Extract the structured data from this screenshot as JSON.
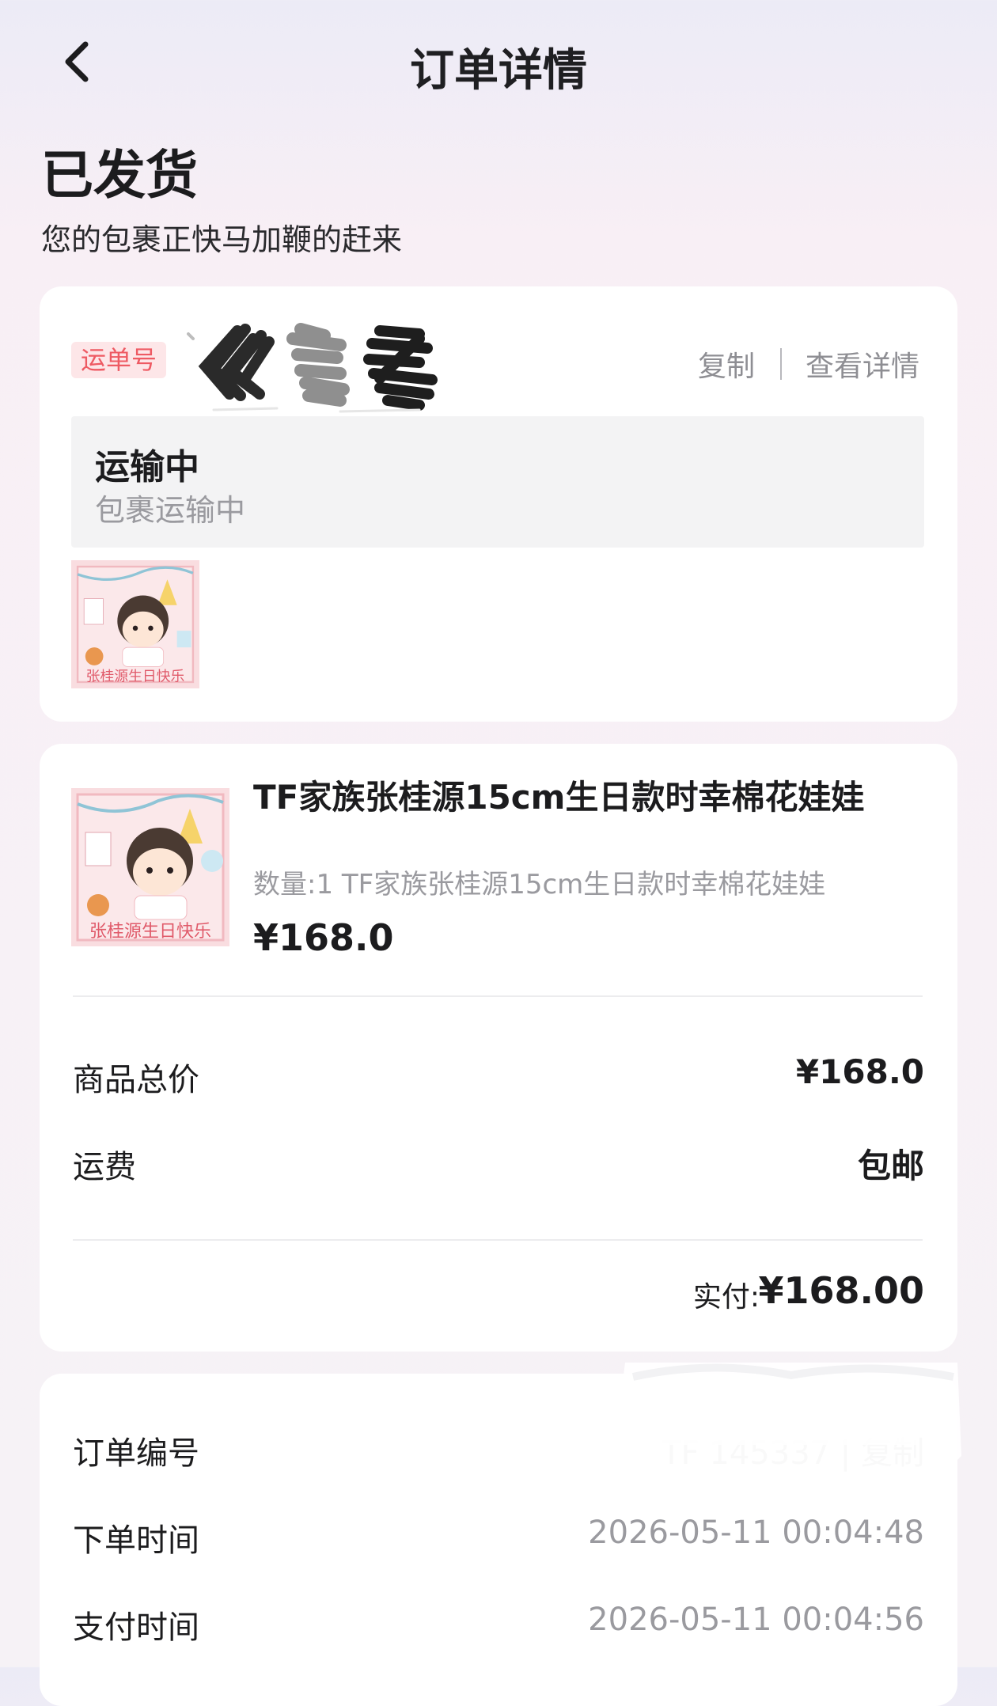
{
  "nav": {
    "title": "订单详情",
    "back_icon": "chevron-left-icon"
  },
  "status": {
    "title": "已发货",
    "subtitle": "您的包裹正快马加鞭的赶来"
  },
  "shipping": {
    "waybill_label": "运单号",
    "copy_label": "复制",
    "separator": "|",
    "detail_label": "查看详情",
    "state_title": "运输中",
    "state_subtitle": "包裹运输中",
    "thumb_caption": "张桂源生日快乐"
  },
  "product": {
    "name": "TF家族张桂源15cm生日款时幸棉花娃娃",
    "spec": "数量:1 TF家族张桂源15cm生日款时幸棉花娃娃",
    "price": "¥168.0",
    "thumb_caption": "张桂源生日快乐"
  },
  "summary": {
    "goods_total_label": "商品总价",
    "goods_total_value": "¥168.0",
    "shipping_fee_label": "运费",
    "shipping_fee_value": "包邮",
    "paid_label": "实付:",
    "paid_value": "¥168.00"
  },
  "order_info": {
    "order_no_label": "订单编号",
    "order_no_value": "TF 145337 | 复制",
    "order_time_label": "下单时间",
    "order_time_value": "2026-05-11 00:04:48",
    "pay_time_label": "支付时间",
    "pay_time_value": "2026-05-11 00:04:56"
  },
  "colors": {
    "accent_red": "#ee5a63",
    "tag_bg": "#fde6e8",
    "muted": "#9a9a9f"
  }
}
